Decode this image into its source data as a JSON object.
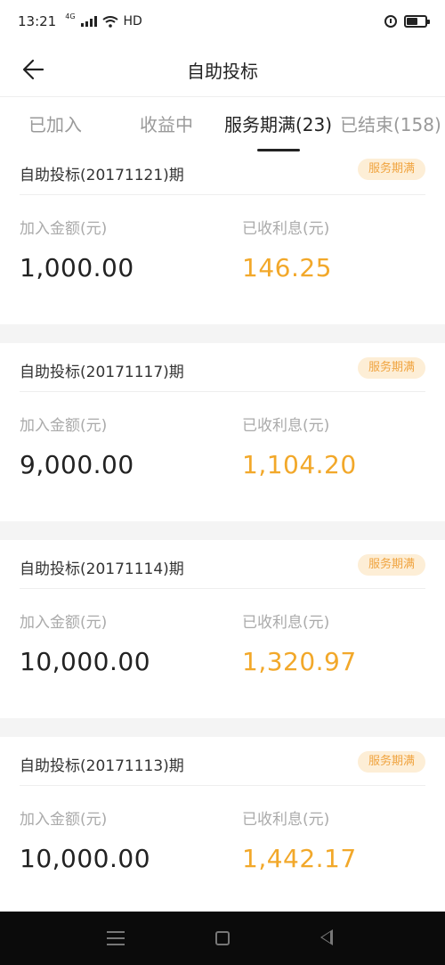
{
  "status_bar": {
    "time": "13:21",
    "network": "4G",
    "hd": "HD"
  },
  "header": {
    "title": "自助投标"
  },
  "tabs": [
    {
      "label": "已加入"
    },
    {
      "label": "收益中"
    },
    {
      "label": "服务期满(23)"
    },
    {
      "label": "已结束(158)"
    }
  ],
  "cards": [
    {
      "name": "自助投标(20171121)期",
      "badge": "服务期满",
      "amount_label": "加入金额(元)",
      "amount": "1,000.00",
      "interest_label": "已收利息(元)",
      "interest": "146.25"
    },
    {
      "name": "自助投标(20171117)期",
      "badge": "服务期满",
      "amount_label": "加入金额(元)",
      "amount": "9,000.00",
      "interest_label": "已收利息(元)",
      "interest": "1,104.20"
    },
    {
      "name": "自助投标(20171114)期",
      "badge": "服务期满",
      "amount_label": "加入金额(元)",
      "amount": "10,000.00",
      "interest_label": "已收利息(元)",
      "interest": "1,320.97"
    },
    {
      "name": "自助投标(20171113)期",
      "badge": "服务期满",
      "amount_label": "加入金额(元)",
      "amount": "10,000.00",
      "interest_label": "已收利息(元)",
      "interest": "1,442.17"
    }
  ],
  "colors": {
    "accent": "#f2a82a",
    "badge_bg": "#fdeed6",
    "badge_text": "#f0a440"
  },
  "icons": [
    "back-arrow-icon",
    "wifi-icon",
    "signal-icon",
    "alarm-icon",
    "battery-icon",
    "menu-icon",
    "home-icon",
    "nav-back-icon"
  ]
}
